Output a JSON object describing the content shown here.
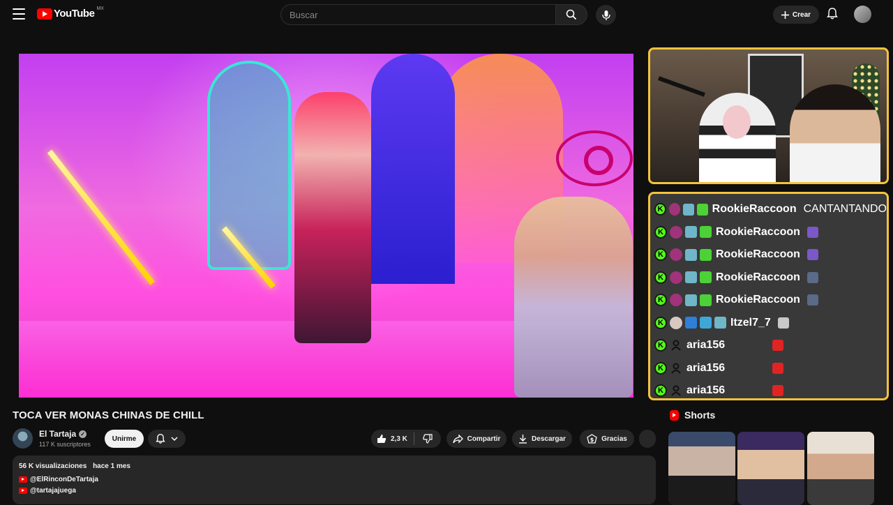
{
  "header": {
    "logo_text": "YouTube",
    "country_code": "MX",
    "search_placeholder": "Buscar",
    "create_label": "Crear"
  },
  "video": {
    "title": "TOCA VER MONAS CHINAS DE CHILL"
  },
  "chat_overlay": {
    "rows": [
      {
        "user": "RookieRaccoon",
        "message": "CANTANTANDO"
      },
      {
        "user": "RookieRaccoon",
        "message": ""
      },
      {
        "user": "RookieRaccoon",
        "message": ""
      },
      {
        "user": "RookieRaccoon",
        "message": ""
      },
      {
        "user": "RookieRaccoon",
        "message": ""
      },
      {
        "user": "Itzel7_7",
        "message": ""
      },
      {
        "user": "aria156",
        "message": ""
      },
      {
        "user": "aria156",
        "message": ""
      },
      {
        "user": "aria156",
        "message": ""
      }
    ],
    "platform_badge": "K"
  },
  "channel": {
    "name": "El Tartaja",
    "subscribers": "117 K suscriptores",
    "join_label": "Unirme"
  },
  "actions": {
    "likes": "2,3 K",
    "share_label": "Compartir",
    "download_label": "Descargar",
    "thanks_label": "Gracias"
  },
  "description": {
    "views": "56 K visualizaciones",
    "date": "hace 1 mes",
    "links": [
      "@ElRinconDeTartaja",
      "@tartajajuega"
    ]
  },
  "shorts": {
    "heading": "Shorts"
  },
  "colors": {
    "background": "#0f0f0f",
    "overlay_border": "#f5c33b",
    "kick_green": "#53fc18",
    "youtube_red": "#ff0000"
  }
}
